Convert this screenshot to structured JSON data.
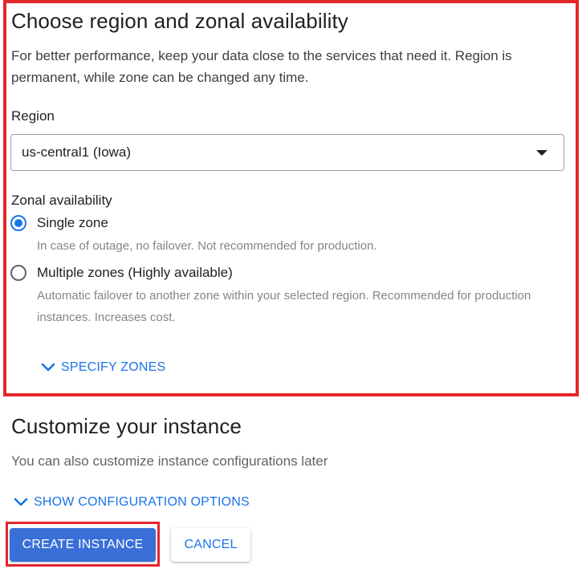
{
  "region_section": {
    "title": "Choose region and zonal availability",
    "description": "For better performance, keep your data close to the services that need it. Region is permanent, while zone can be changed any time.",
    "region_label": "Region",
    "region_value": "us-central1 (Iowa)",
    "zonal_label": "Zonal availability",
    "options": [
      {
        "label": "Single zone",
        "help": "In case of outage, no failover. Not recommended for production.",
        "selected": true
      },
      {
        "label": "Multiple zones (Highly available)",
        "help": "Automatic failover to another zone within your selected region. Recommended for production instances. Increases cost.",
        "selected": false
      }
    ],
    "specify_zones_label": "SPECIFY ZONES"
  },
  "customize_section": {
    "title": "Customize your instance",
    "description": "You can also customize instance configurations later",
    "show_config_label": "SHOW CONFIGURATION OPTIONS"
  },
  "actions": {
    "create_label": "CREATE INSTANCE",
    "cancel_label": "CANCEL"
  },
  "colors": {
    "accent": "#1a73e8",
    "primary_button": "#3a6fd8",
    "highlight": "#e3262b"
  },
  "icons": {
    "dropdown": "caret-down-icon",
    "expand": "chevron-down-icon",
    "radio_selected": "radio-checked-icon",
    "radio_unselected": "radio-unchecked-icon"
  }
}
